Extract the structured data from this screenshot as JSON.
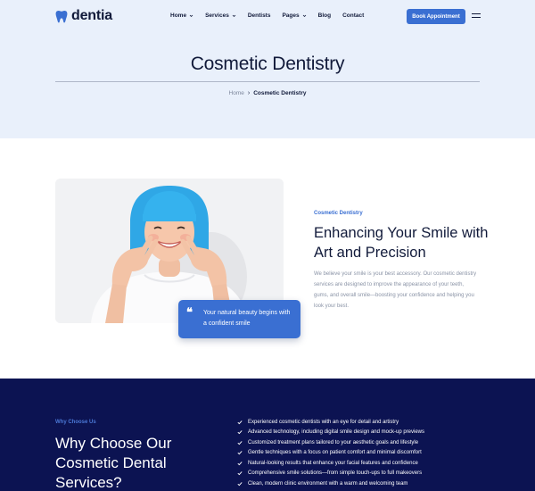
{
  "brand": {
    "name": "dentia"
  },
  "nav": {
    "items": [
      {
        "label": "Home",
        "dropdown": true
      },
      {
        "label": "Services",
        "dropdown": true
      },
      {
        "label": "Dentists",
        "dropdown": false
      },
      {
        "label": "Pages",
        "dropdown": true
      },
      {
        "label": "Blog",
        "dropdown": false
      },
      {
        "label": "Contact",
        "dropdown": false
      }
    ],
    "cta_label": "Book Appointment"
  },
  "hero": {
    "title": "Cosmetic Dentistry",
    "breadcrumb": {
      "home": "Home",
      "separator": "›",
      "current": "Cosmetic Dentistry"
    }
  },
  "intro": {
    "label": "Cosmetic Dentistry",
    "heading": "Enhancing Your Smile with Art and Precision",
    "body": "We believe your smile is your best accessory. Our cosmetic dentistry services are designed to improve the appearance of your teeth, gums, and overall smile—boosting your confidence and helping you look your best.",
    "quote": "Your natural beauty begins with a confident smile"
  },
  "why": {
    "label": "Why Choose Us",
    "heading": "Why Choose Our Cosmetic Dental Services?",
    "points": [
      "Experienced cosmetic dentists with an eye for detail and artistry",
      "Advanced technology, including digital smile design and mock-up previews",
      "Customized treatment plans tailored to your aesthetic goals and lifestyle",
      "Gentle techniques with a focus on patient comfort and minimal discomfort",
      "Natural-looking results that enhance your facial features and confidence",
      "Comprehensive smile solutions—from simple touch-ups to full makeovers",
      "Clean, modern clinic environment with a warm and welcoming team"
    ]
  },
  "colors": {
    "primary": "#3a6fd2",
    "navy": "#0c1352",
    "hero_bg": "#e9f0fb",
    "text_dark": "#111a3a"
  },
  "icons": {
    "logo": "tooth-icon",
    "menu": "hamburger-icon",
    "quote": "quote-icon",
    "check": "check-icon",
    "dropdown": "chevron-down-icon"
  }
}
